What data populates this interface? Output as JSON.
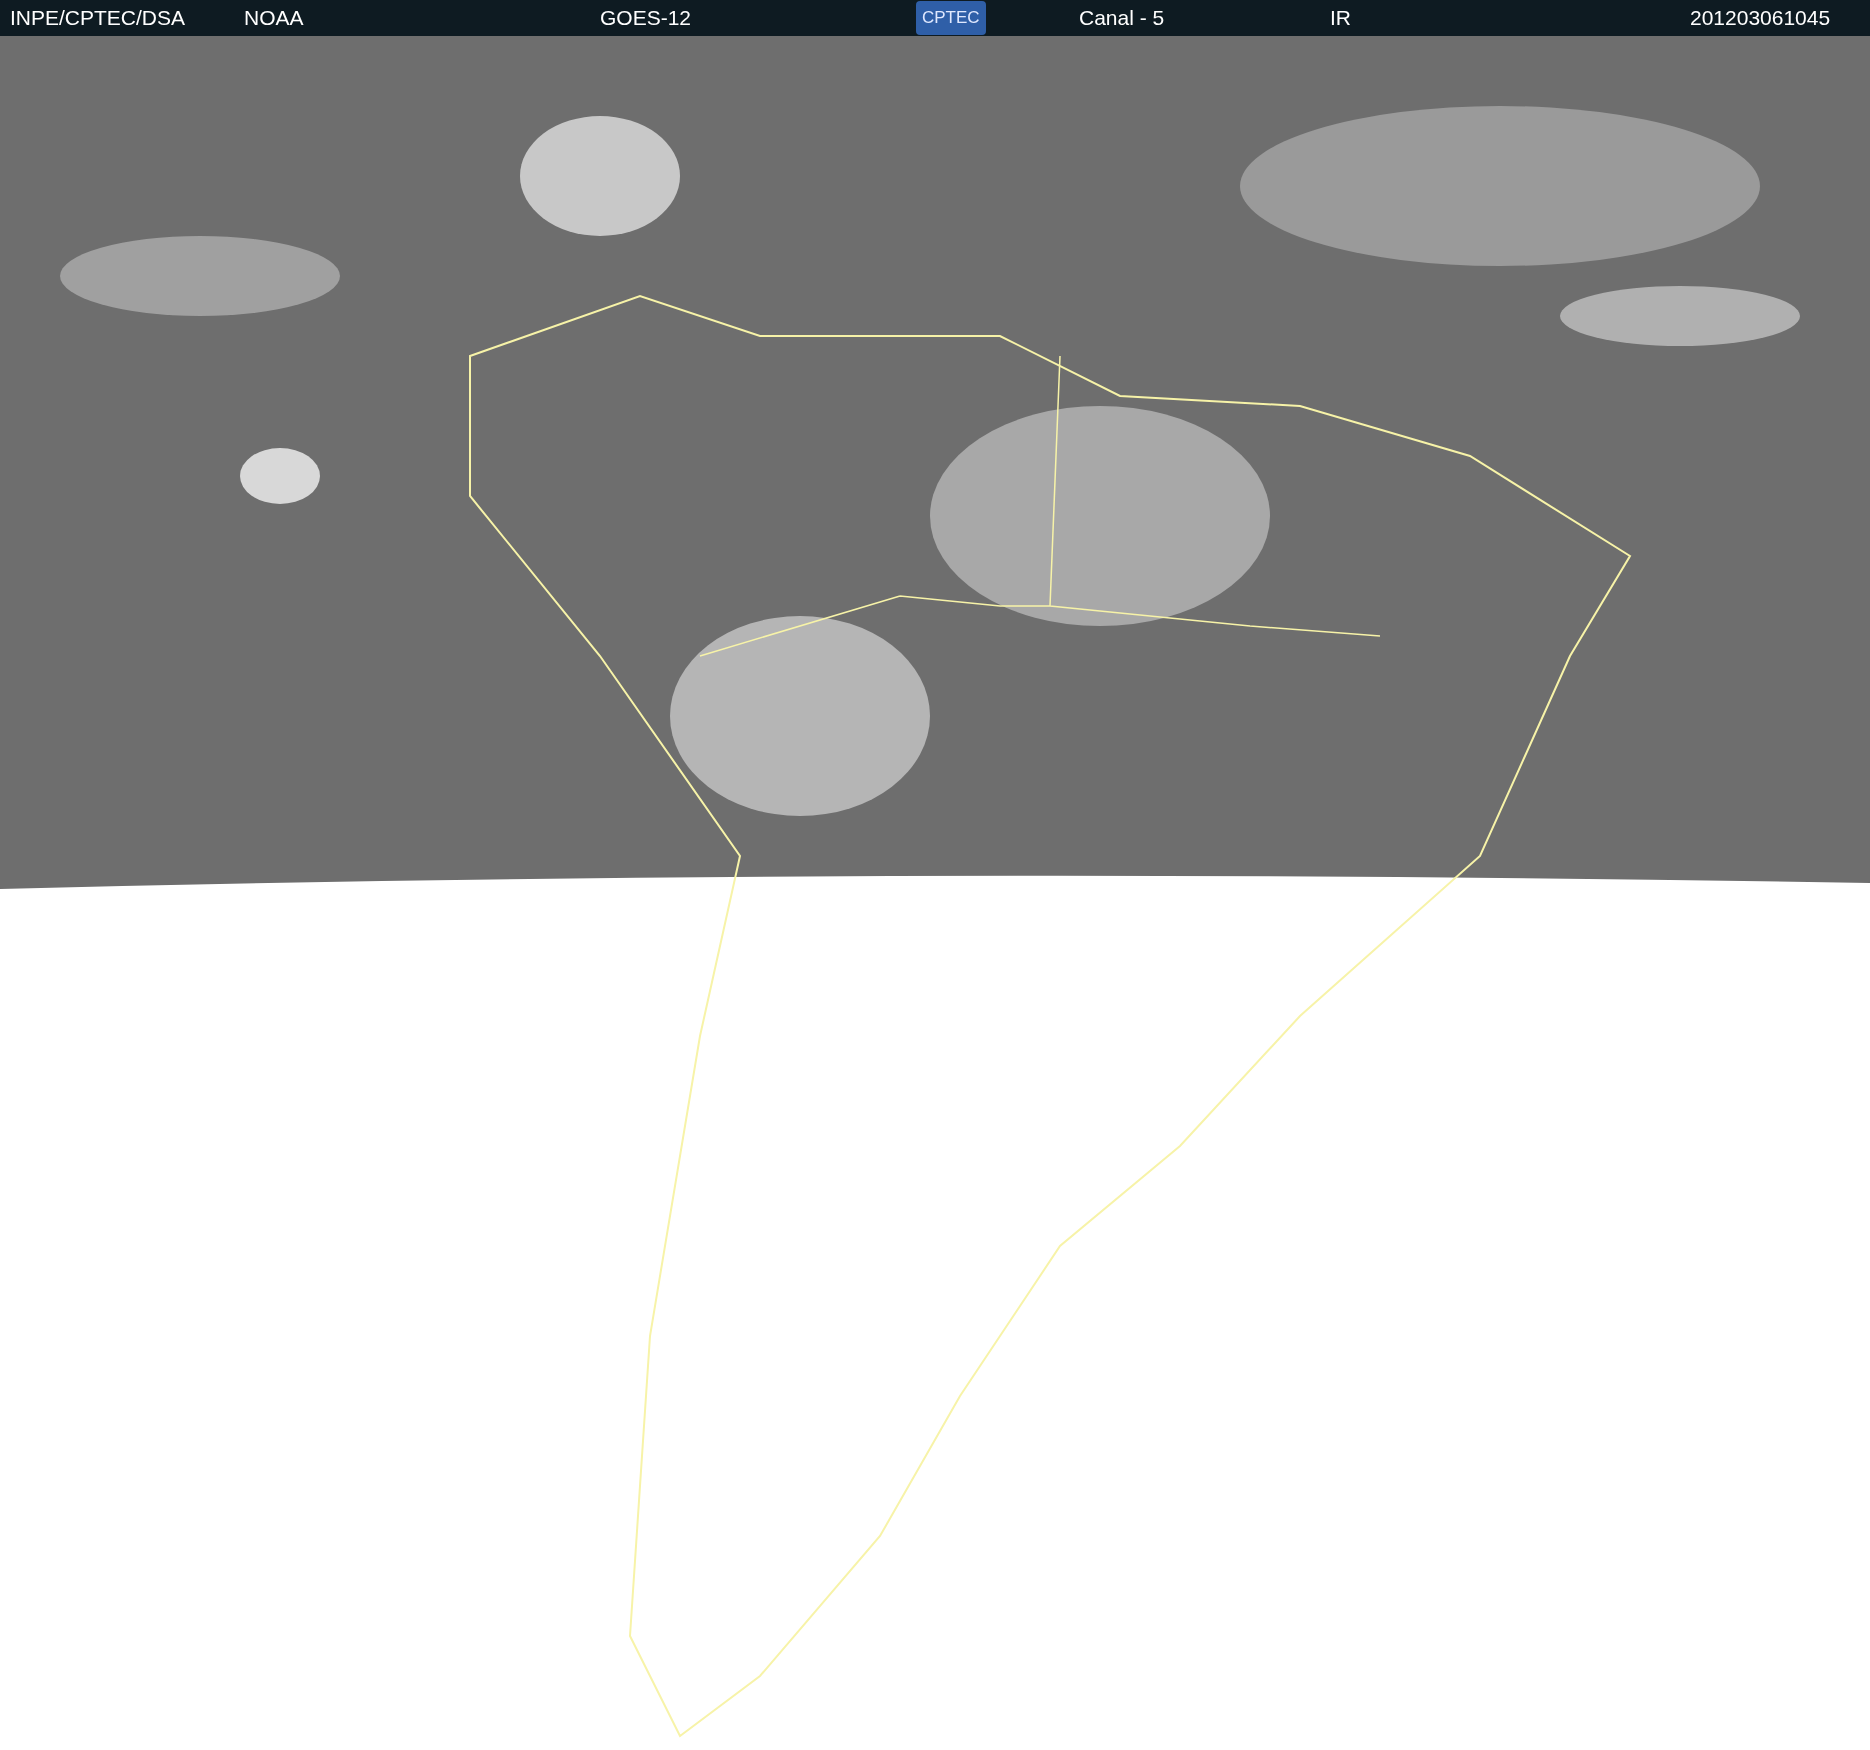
{
  "header": {
    "items": [
      {
        "kind": "text",
        "text": "INPE/CPTEC/DSA"
      },
      {
        "kind": "text",
        "text": "NOAA"
      },
      {
        "kind": "text",
        "text": "GOES-12"
      },
      {
        "kind": "logo",
        "text": "CPTEC"
      },
      {
        "kind": "text",
        "text": "Canal - 5"
      },
      {
        "kind": "text",
        "text": "IR"
      },
      {
        "kind": "text",
        "text": "201203061045"
      }
    ]
  }
}
